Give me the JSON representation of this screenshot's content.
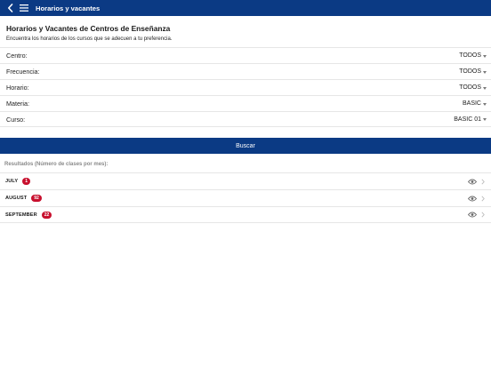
{
  "header": {
    "title": "Horarios y vacantes"
  },
  "page": {
    "title": "Horarios y Vacantes de Centros de Enseñanza",
    "subtitle": "Encuentra los horarios de los cursos que se adecuen a tu preferencia."
  },
  "filters": [
    {
      "label": "Centro:",
      "value": "TODOS"
    },
    {
      "label": "Frecuencia:",
      "value": "TODOS"
    },
    {
      "label": "Horario:",
      "value": "TODOS"
    },
    {
      "label": "Materia:",
      "value": "BASIC"
    },
    {
      "label": "Curso:",
      "value": "BASIC 01"
    }
  ],
  "search_button": {
    "label": "Buscar"
  },
  "results": {
    "label": "Resultados (Número de clases por mes):",
    "items": [
      {
        "month": "JULY",
        "count": "1"
      },
      {
        "month": "AUGUST",
        "count": "92"
      },
      {
        "month": "SEPTEMBER",
        "count": "22"
      }
    ]
  },
  "colors": {
    "brand": "#0b3a84",
    "badge": "#c8102e"
  },
  "icons": [
    "back-icon",
    "menu-icon",
    "chevron-down-icon",
    "eye-icon",
    "chevron-right-icon"
  ]
}
